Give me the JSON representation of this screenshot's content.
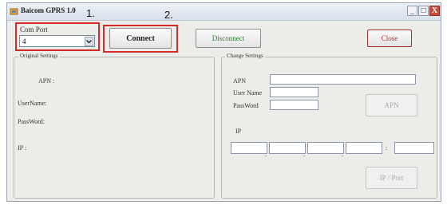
{
  "window": {
    "title": "Baicom GPRS 1.0",
    "controls": {
      "minimize": "_",
      "maximize": "□",
      "close": "X"
    }
  },
  "annotations": {
    "step1": "1.",
    "step2": "2."
  },
  "com_port": {
    "label": "Com Port",
    "value": "4"
  },
  "buttons": {
    "connect": "Connect",
    "disconnect": "Disconnect",
    "close": "Close",
    "apn": "APN",
    "ip_port": "IP / Port"
  },
  "original_settings": {
    "title": "Original Settings",
    "apn_label": "APN :",
    "username_label": "UserName:",
    "password_label": "PassWord:",
    "ip_label": "IP :"
  },
  "change_settings": {
    "title": "Change Settings",
    "apn_label": "APN",
    "username_label": "User Name",
    "password_label": "PassWord",
    "ip_label": "IP",
    "port_separator": ":"
  }
}
